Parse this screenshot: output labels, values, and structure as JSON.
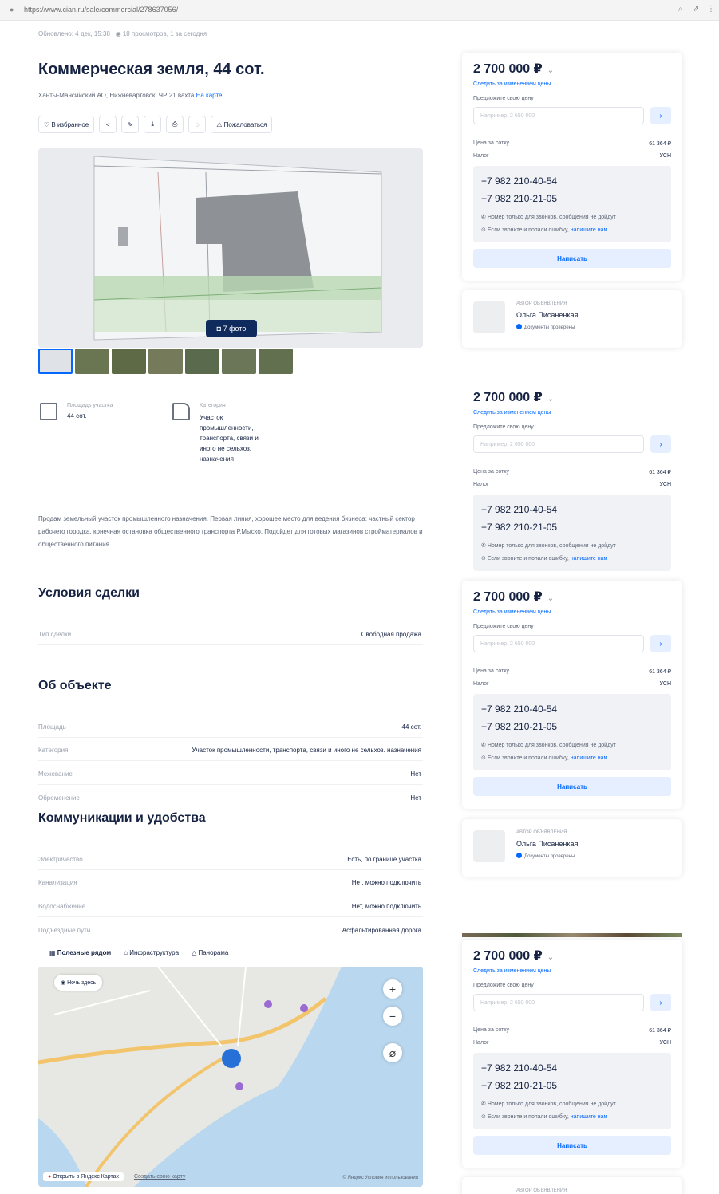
{
  "browser": {
    "url": "https://www.cian.ru/sale/commercial/278637056/"
  },
  "meta": {
    "updated": "Обновлено: 4 дек, 15:38",
    "views": "18 просмотров, 1 за сегодня"
  },
  "listing": {
    "title": "Коммерческая земля, 44 сот.",
    "address": "Ханты-Мансийский АО, Нижневартовск, ЧР 21 вахта",
    "address_link": "На карте",
    "favorite_label": "В избранное",
    "complain_label": "Пожаловаться",
    "photo_count": "7 фото",
    "features": [
      {
        "label": "Площадь участка",
        "value": "44 сот."
      },
      {
        "label": "Категория",
        "value": "Участок промышленности, транспорта, связи и иного не сельхоз. назначения"
      }
    ],
    "description": "Продам земельный участок промышленного назначения. Первая линия, хорошее место для ведения бизнеса: частный сектор рабочего городка, конечная остановка общественного транспорта Р.Мыско. Подойдет для готовых магазинов стройматериалов и общественного питания."
  },
  "deal": {
    "title": "Условия сделки",
    "rows": [
      {
        "k": "Тип сделки",
        "v": "Свободная продажа"
      }
    ]
  },
  "object": {
    "title": "Об объекте",
    "rows": [
      {
        "k": "Площадь",
        "v": "44 сот."
      },
      {
        "k": "Категория",
        "v": "Участок промышленности, транспорта, связи и иного не сельхоз. назначения"
      },
      {
        "k": "Межевание",
        "v": "Нет"
      },
      {
        "k": "Обременение",
        "v": "Нет"
      }
    ]
  },
  "utilities": {
    "title": "Коммуникации и удобства",
    "rows": [
      {
        "k": "Электричество",
        "v": "Есть, по границе участка"
      },
      {
        "k": "Канализация",
        "v": "Нет, можно подключить"
      },
      {
        "k": "Водоснабжение",
        "v": "Нет, можно подключить"
      },
      {
        "k": "Подъездные пути",
        "v": "Асфальтированная дорога"
      }
    ]
  },
  "map": {
    "tabs": [
      "Полезные рядом",
      "Инфраструктура",
      "Панорама"
    ],
    "nearby_label": "Ночь здесь",
    "open_link": "Открыть в Яндекс Картах",
    "mistake_link": "Создать свою карту",
    "terms": "© Яндекс Условия использования"
  },
  "sidebar": {
    "price": "2 700 000 ₽",
    "watch_link": "Следить за изменением цены",
    "offer_label": "Предложите свою цену",
    "offer_placeholder": "Например, 2 650 000",
    "per_unit_label": "Цена за сотку",
    "per_unit_value": "61 364 ₽",
    "tax_label": "Налог",
    "tax_value": "УСН",
    "phone1": "+7 982 210-40-54",
    "phone2": "+7 982 210-21-05",
    "note1": "Номер только для звонков, сообщения не дойдут",
    "note2": "Если звоните и попали ошибку,",
    "note2_link": "напишите нам",
    "write_label": "Написать",
    "author_label": "АВТОР ОБЪЯВЛЕНИЯ",
    "author_name": "Ольга Писаненкая",
    "docs_label": "Документы проверены"
  }
}
